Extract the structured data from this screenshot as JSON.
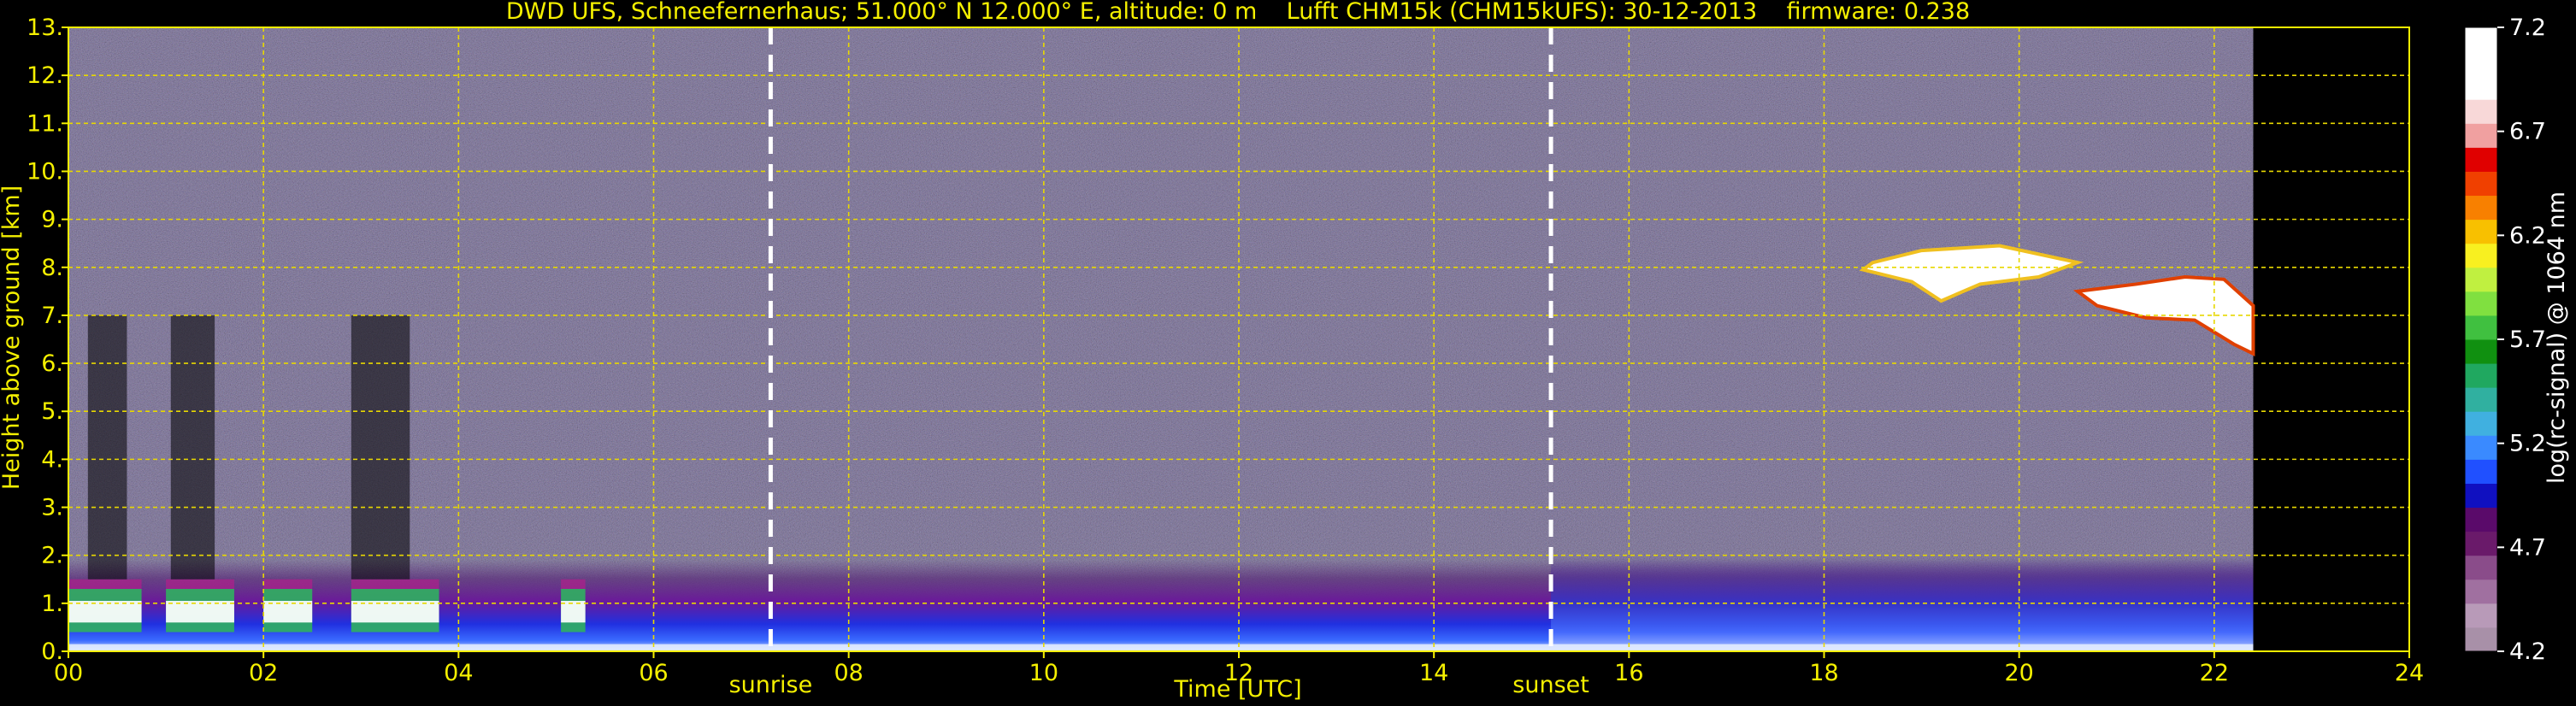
{
  "chart_data": {
    "type": "heatmap",
    "title": "DWD UFS, Schneefernerhaus; 51.000° N 12.000° E, altitude: 0 m    Lufft CHM15k (CHM15kUFS): 30-12-2013    firmware: 0.238",
    "xlabel": "Time [UTC]",
    "ylabel": "Height above ground [km]",
    "xlim": [
      0,
      24
    ],
    "ylim": [
      0,
      13
    ],
    "x_ticks": [
      "00",
      "02",
      "04",
      "06",
      "08",
      "10",
      "12",
      "14",
      "16",
      "18",
      "20",
      "22",
      "24"
    ],
    "y_ticks": [
      "0.",
      "1.",
      "2.",
      "3.",
      "4.",
      "5.",
      "6.",
      "7.",
      "8.",
      "9.",
      "10.",
      "11.",
      "12.",
      "13."
    ],
    "grid": true,
    "data_end_hour": 22.4,
    "markers": [
      {
        "label": "sunrise",
        "hour": 7.2
      },
      {
        "label": "sunset",
        "hour": 15.2
      }
    ],
    "colorbar": {
      "label": "log(rc-signal) @ 1064 nm",
      "range": [
        4.2,
        7.2
      ],
      "ticks": [
        "7.2",
        "6.7",
        "6.2",
        "5.7",
        "5.2",
        "4.7",
        "4.2"
      ],
      "colors": [
        "#a890a8",
        "#b89ab8",
        "#a070a0",
        "#8a4c8a",
        "#6a1a6a",
        "#5a0a6a",
        "#1010c0",
        "#2050ff",
        "#3a8aff",
        "#40b0e0",
        "#30b0a0",
        "#20a860",
        "#109010",
        "#40c040",
        "#80e040",
        "#c0f040",
        "#f8f020",
        "#f8c000",
        "#f88000",
        "#f04000",
        "#e00000",
        "#f0a0a0",
        "#f8d8d8",
        "#ffffff",
        "#ffffff",
        "#ffffff"
      ]
    },
    "features": [
      {
        "name": "boundary layer aerosol",
        "x_start": 0,
        "x_end": 22.4,
        "y_top": 1.9
      },
      {
        "name": "low cloud",
        "x_start": 0,
        "x_end": 5.3,
        "y_bottom": 0.4,
        "y_top": 1.3
      },
      {
        "name": "cirrus cloud",
        "x_start": 18.3,
        "x_end": 22.4,
        "y_bottom": 6.0,
        "y_top": 8.4
      }
    ]
  }
}
